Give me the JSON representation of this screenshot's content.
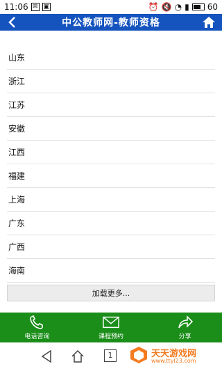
{
  "status_bar": {
    "time": "11:06",
    "battery": "60"
  },
  "header": {
    "title": "中公教师网-教师资格"
  },
  "provinces": [
    "山东",
    "浙江",
    "江苏",
    "安徽",
    "江西",
    "福建",
    "上海",
    "广东",
    "广西",
    "海南"
  ],
  "load_more_label": "加载更多...",
  "footer": {
    "phone_label": "电话咨询",
    "course_label": "课程预约",
    "share_label": "分享"
  },
  "navbar": {
    "square_label": "1"
  },
  "watermark": {
    "brand": "天天游戏网",
    "url": "www.ttyl23.com"
  },
  "colors": {
    "header": "#1554bf",
    "footer": "#1b8e19",
    "watermark": "#f47b20"
  }
}
